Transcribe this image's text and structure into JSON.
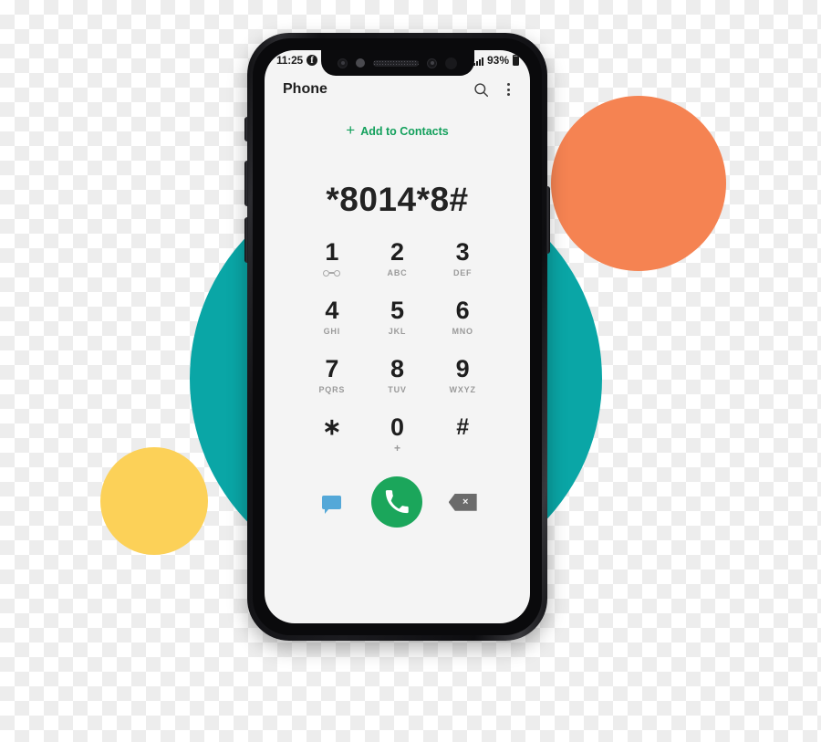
{
  "decor": {
    "teal_color": "#0AA6A6",
    "orange_color": "#F58352",
    "yellow_color": "#FCD158"
  },
  "status_bar": {
    "time": "11:25",
    "facebook_badge": "f",
    "battery_percent": "93%",
    "signal_icon": "signal-bars-icon",
    "battery_icon": "battery-icon"
  },
  "app": {
    "title": "Phone",
    "search_icon": "search-icon",
    "overflow_icon": "more-options-icon"
  },
  "add_contacts": {
    "plus": "+",
    "label": "Add to Contacts",
    "color": "#13a05c"
  },
  "dialer": {
    "number": "*8014*8#"
  },
  "keypad": [
    {
      "digit": "1",
      "sub": "",
      "icon": "voicemail-icon"
    },
    {
      "digit": "2",
      "sub": "ABC",
      "icon": ""
    },
    {
      "digit": "3",
      "sub": "DEF",
      "icon": ""
    },
    {
      "digit": "4",
      "sub": "GHI",
      "icon": ""
    },
    {
      "digit": "5",
      "sub": "JKL",
      "icon": ""
    },
    {
      "digit": "6",
      "sub": "MNO",
      "icon": ""
    },
    {
      "digit": "7",
      "sub": "PQRS",
      "icon": ""
    },
    {
      "digit": "8",
      "sub": "TUV",
      "icon": ""
    },
    {
      "digit": "9",
      "sub": "WXYZ",
      "icon": ""
    },
    {
      "digit": "∗",
      "sub": "",
      "icon": ""
    },
    {
      "digit": "0",
      "sub": "+",
      "icon": ""
    },
    {
      "digit": "#",
      "sub": "",
      "icon": ""
    }
  ],
  "actions": {
    "message_icon": "message-icon",
    "message_color": "#54A8D8",
    "call_icon": "call-icon",
    "call_color": "#1BA65B",
    "backspace_icon": "backspace-icon",
    "backspace_glyph": "×",
    "backspace_color": "#6b6b6b"
  }
}
